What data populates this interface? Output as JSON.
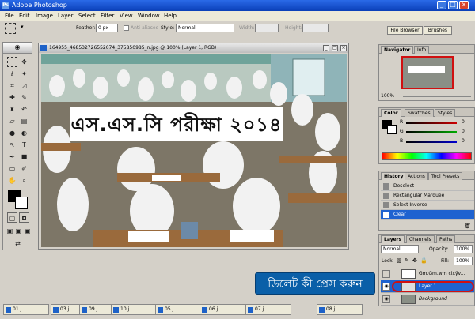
{
  "window": {
    "title": "Adobe Photoshop",
    "min": "_",
    "max": "□",
    "close": "×"
  },
  "menu": [
    "File",
    "Edit",
    "Image",
    "Layer",
    "Select",
    "Filter",
    "View",
    "Window",
    "Help"
  ],
  "options": {
    "feather_label": "Feather:",
    "feather_value": "0 px",
    "antialiased_label": "Anti-aliased",
    "style_label": "Style:",
    "style_value": "Normal",
    "width_label": "Width:",
    "height_label": "Height:",
    "file_browser": "File Browser",
    "brushes": "Brushes"
  },
  "document": {
    "title": "164955_468532726552074_375850985_n.jpg @ 100% (Layer 1, RGB)"
  },
  "overlay_text": "এস.এস.সি পরীক্ষা ২০১৪",
  "panels": {
    "navigator": {
      "tabs": [
        "Navigator",
        "Info"
      ],
      "zoom": "100%"
    },
    "color": {
      "tabs": [
        "Color",
        "Swatches",
        "Styles"
      ],
      "channels": [
        {
          "label": "R",
          "value": "0",
          "color": "#cc0000"
        },
        {
          "label": "G",
          "value": "0",
          "color": "#00aa00"
        },
        {
          "label": "B",
          "value": "0",
          "color": "#0000cc"
        }
      ]
    },
    "history": {
      "tabs": [
        "History",
        "Actions",
        "Tool Presets"
      ],
      "items": [
        "Deselect",
        "Rectangular Marquee",
        "Select Inverse",
        "Clear"
      ],
      "selected_index": 3
    },
    "layers": {
      "tabs": [
        "Layers",
        "Channels",
        "Paths"
      ],
      "blend_mode": "Normal",
      "opacity_label": "Opacity:",
      "opacity": "100%",
      "lock_label": "Lock:",
      "fill_label": "Fill:",
      "fill": "100%",
      "items": [
        "Gm.Gm.wm cixÿv...",
        "Layer 1",
        "Background"
      ]
    }
  },
  "callout_text": "ডিলেট কী প্রেস করুন",
  "taskbar": [
    "01.j...",
    "03.j...",
    "09.j...",
    "10.j...",
    "05.j...",
    "06.j...",
    "07.j...",
    "08.j..."
  ],
  "colors": {
    "titlebar": "#0a3fb8",
    "selection": "#1e62d0",
    "callout": "#0a5fa8"
  }
}
